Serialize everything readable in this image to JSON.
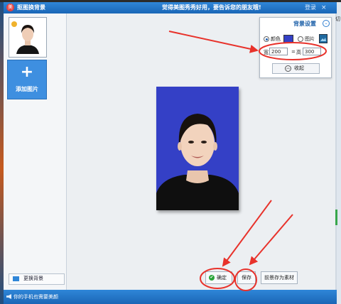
{
  "titlebar": {
    "app_logo": "美",
    "title": "抠图换背景",
    "promo": "觉得美图秀秀好用，要告诉您的朋友哦!",
    "login": "登录",
    "close": "×"
  },
  "left_panel": {
    "add_label": "添加图片",
    "add_plus": "+",
    "change_bg_label": "更换背景"
  },
  "settings": {
    "title": "背景设置",
    "collapse_icon": "⌄",
    "color_label": "颜色",
    "color_swatch": "#3440c6",
    "image_label": "图片",
    "width_label": "宽",
    "width_value": "200",
    "eq": "=",
    "height_label": "高",
    "height_value": "300",
    "collapse_btn_icon": "︽",
    "collapse_btn_label": "收起"
  },
  "buttons": {
    "confirm_icon": "✔",
    "confirm_label": "确定",
    "save_label": "保存",
    "save_as_label": "前景存为素材"
  },
  "side": {
    "tab_label": "切"
  },
  "status": {
    "text": "你的手机也需要美颜"
  },
  "colors": {
    "accent": "#1a66b6",
    "annotation": "#e8322b",
    "background_blue": "#3440c6"
  },
  "icons": [
    "app-logo-icon",
    "close-icon",
    "add-icon",
    "change-background-icon",
    "settings-collapse-icon",
    "image-icon",
    "collapse-icon",
    "check-icon",
    "speaker-icon"
  ]
}
